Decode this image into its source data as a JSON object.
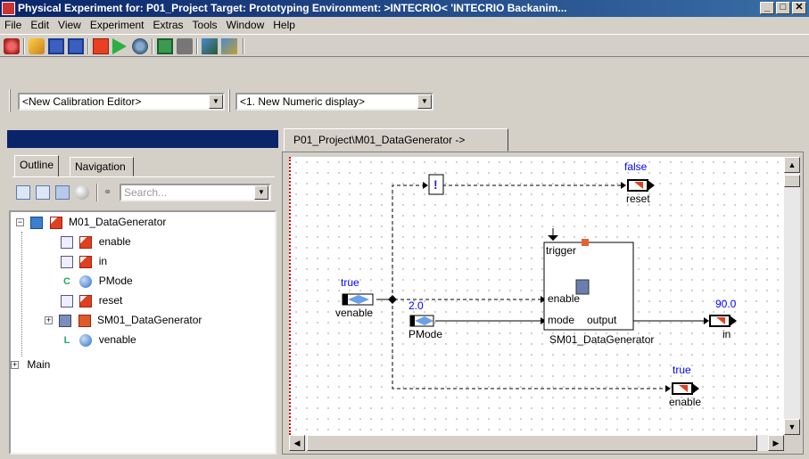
{
  "window": {
    "title": "Physical Experiment for: P01_Project  Target: Prototyping  Environment: >INTECRIO<  'INTECRIO Backanim...",
    "minimize": "_",
    "maximize": "□",
    "close": "✕"
  },
  "menu": [
    "File",
    "Edit",
    "View",
    "Experiment",
    "Extras",
    "Tools",
    "Window",
    "Help"
  ],
  "toolbar": {
    "calibration_editor": "<New Calibration Editor>",
    "numeric_display": "<1. New Numeric display>"
  },
  "left_panel": {
    "tabs": [
      "Outline",
      "Navigation"
    ],
    "search_placeholder": "Search...",
    "tree": [
      {
        "label": "M01_DataGenerator"
      },
      {
        "label": "enable"
      },
      {
        "label": "in"
      },
      {
        "label": "PMode"
      },
      {
        "label": "reset"
      },
      {
        "label": "SM01_DataGenerator"
      },
      {
        "label": "venable"
      },
      {
        "label": "Main"
      }
    ]
  },
  "editor": {
    "tab_label": "P01_Project\\M01_DataGenerator ->",
    "diagram": {
      "reset_value": "false",
      "reset_label": "reset",
      "venable_value": "true",
      "venable_label": "venable",
      "pmode_value": "2.0",
      "pmode_label": "PMode",
      "block_trigger": "trigger",
      "block_enable": "enable",
      "block_mode": "mode",
      "block_output": "output",
      "block_name": "SM01_DataGenerator",
      "in_value": "90.0",
      "in_label": "in",
      "enable_value": "true",
      "enable_label": "enable"
    }
  },
  "colors": {
    "titlebar": "#0a246a",
    "value_text": "#0000ff",
    "grid_border": "#cc0000"
  }
}
